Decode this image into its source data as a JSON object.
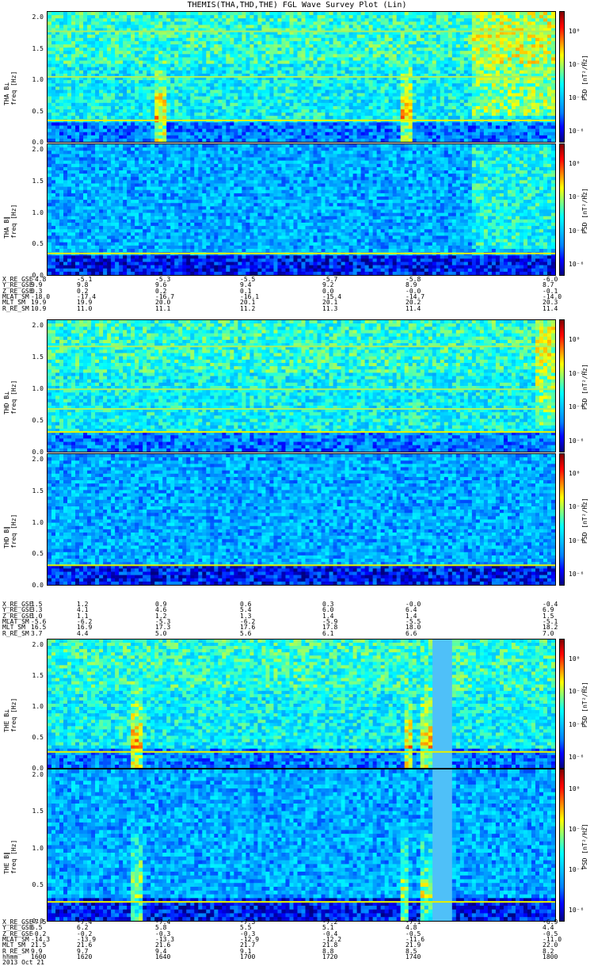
{
  "title": "THEMIS(THA,THD,THE) FGL Wave Survey Plot (Lin)",
  "colors": {
    "background": "#ffffff",
    "ink": "#000000",
    "colormap": [
      "#000080",
      "#0000ff",
      "#0080ff",
      "#00c0ff",
      "#00ffff",
      "#80ff80",
      "#ffff00",
      "#ff8000",
      "#ff0000",
      "#800000"
    ]
  },
  "freq_axis": {
    "ticks": [
      "0.0",
      "0.5",
      "1.0",
      "1.5",
      "2.0"
    ],
    "label": "freq [Hz]"
  },
  "colorbar": {
    "label": "PSD [nT²/Hz]",
    "ticks": [
      "10⁰",
      "10⁻²",
      "10⁻⁴",
      "10⁻⁶"
    ]
  },
  "panels": [
    {
      "id": "tha_bl",
      "name": "THA B⊥",
      "ylabel_prefix": "THA B⊥"
    },
    {
      "id": "tha_bpar",
      "name": "THA B∥",
      "ylabel_prefix": "THA B∥"
    },
    {
      "id": "thd_bl",
      "name": "THD B⊥",
      "ylabel_prefix": "THD B⊥"
    },
    {
      "id": "thd_bpar",
      "name": "THD B∥",
      "ylabel_prefix": "THD B∥"
    },
    {
      "id": "the_bl",
      "name": "THE B⊥",
      "ylabel_prefix": "THE B⊥"
    },
    {
      "id": "the_bpar",
      "name": "THE B∥",
      "ylabel_prefix": "THE B∥"
    }
  ],
  "ephemeris": [
    {
      "rows": [
        {
          "name": "X_RE_GSE",
          "values": [
            "-4.8",
            "-5.1",
            "-5.3",
            "-5.5",
            "-5.7",
            "-5.8",
            "-6.0"
          ]
        },
        {
          "name": "Y_RE_GSE",
          "values": [
            "9.9",
            "9.8",
            "9.6",
            "9.4",
            "9.2",
            "8.9",
            "8.7"
          ]
        },
        {
          "name": "Z_RE_GSE",
          "values": [
            "0.3",
            "0.2",
            "0.2",
            "0.1",
            "0.0",
            "-0.0",
            "-0.1"
          ]
        },
        {
          "name": "MLAT_SM",
          "values": [
            "-18.0",
            "-17.4",
            "-16.7",
            "-16.1",
            "-15.4",
            "-14.7",
            "-14.0"
          ]
        },
        {
          "name": "MLT_SM",
          "values": [
            "19.9",
            "19.9",
            "20.0",
            "20.1",
            "20.1",
            "20.2",
            "20.3"
          ]
        },
        {
          "name": "R_RE_SM",
          "values": [
            "10.9",
            "11.0",
            "11.1",
            "11.2",
            "11.3",
            "11.4",
            "11.4"
          ]
        }
      ]
    },
    {
      "rows": [
        {
          "name": "X_RE_GSE",
          "values": [
            "1.5",
            "1.2",
            "0.9",
            "0.6",
            "0.3",
            "-0.0",
            "-0.4"
          ]
        },
        {
          "name": "Y_RE_GSE",
          "values": [
            "3.3",
            "4.1",
            "4.6",
            "5.4",
            "6.0",
            "6.4",
            "6.9"
          ]
        },
        {
          "name": "Z_RE_GSE",
          "values": [
            "1.0",
            "1.1",
            "1.2",
            "1.3",
            "1.4",
            "1.4",
            "1.5"
          ]
        },
        {
          "name": "MLAT_SM",
          "values": [
            "-5.6",
            "-6.2",
            "-5.3",
            "-6.2",
            "-5.9",
            "-5.5",
            "-5.1"
          ]
        },
        {
          "name": "MLT_SM",
          "values": [
            "16.5",
            "16.9",
            "17.3",
            "17.6",
            "17.8",
            "18.0",
            "18.2"
          ]
        },
        {
          "name": "R_RE_SM",
          "values": [
            "3.7",
            "4.4",
            "5.0",
            "5.6",
            "6.1",
            "6.6",
            "7.0"
          ]
        }
      ]
    },
    {
      "rows": [
        {
          "name": "X_RE_GSE",
          "values": [
            "-7.5",
            "-7.4",
            "-7.4",
            "-7.3",
            "-7.2",
            "-7.1",
            "-6.9"
          ]
        },
        {
          "name": "Y_RE_GSE",
          "values": [
            "6.5",
            "6.2",
            "5.8",
            "5.5",
            "5.1",
            "4.8",
            "4.4"
          ]
        },
        {
          "name": "Z_RE_GSE",
          "values": [
            "-0.2",
            "-0.2",
            "-0.3",
            "-0.3",
            "-0.4",
            "-0.5",
            "-0.5"
          ]
        },
        {
          "name": "MLAT_SM",
          "values": [
            "-14.3",
            "-13.9",
            "-13.3",
            "-12.9",
            "-12.2",
            "-11.6",
            "-11.0"
          ]
        },
        {
          "name": "MLT_SM",
          "values": [
            "21.5",
            "21.6",
            "21.6",
            "21.7",
            "21.8",
            "21.9",
            "22.0"
          ]
        },
        {
          "name": "R_RE_SM",
          "values": [
            "9.9",
            "9.7",
            "9.4",
            "9.1",
            "8.8",
            "8.5",
            "8.2"
          ]
        },
        {
          "name": "hhmm",
          "values": [
            "1600",
            "1620",
            "1640",
            "1700",
            "1720",
            "1740",
            "1800"
          ]
        }
      ]
    }
  ],
  "date_label": "2013 Oct 21",
  "chart_data": [
    {
      "type": "heatmap",
      "title": "THEMIS(THA,THD,THE) FGL Wave Survey Plot (Lin)",
      "xlabel": "hhmm",
      "x_ticks": [
        "1600",
        "1620",
        "1640",
        "1700",
        "1720",
        "1740",
        "1800"
      ],
      "ylabel": "THA B⊥ freq [Hz]",
      "ylim": [
        0,
        2.0
      ],
      "series": [
        {
          "name": "THA B⊥"
        }
      ],
      "features": {
        "lines_hz": [
          0.33,
          1.0,
          1.7
        ],
        "bursts_min": [
          26.0,
          84.5
        ],
        "high_band_after_min": 100
      }
    },
    {
      "type": "heatmap",
      "ylabel": "THA B∥ freq [Hz]",
      "ylim": [
        0,
        2.0
      ],
      "series": [
        {
          "name": "THA B∥"
        }
      ],
      "features": {
        "lines_hz": [
          0.33
        ],
        "bursts_min": [],
        "high_band_after_min": 100
      }
    },
    {
      "type": "heatmap",
      "ylabel": "THD B⊥ freq [Hz]",
      "ylim": [
        0,
        2.0
      ],
      "series": [
        {
          "name": "THD B⊥"
        }
      ],
      "features": {
        "lines_hz": [
          0.3,
          0.65,
          0.95,
          1.6
        ],
        "bursts_min": [],
        "high_band_after_min": 115
      }
    },
    {
      "type": "heatmap",
      "ylabel": "THD B∥ freq [Hz]",
      "ylim": [
        0,
        2.0
      ],
      "series": [
        {
          "name": "THD B∥"
        }
      ],
      "features": {
        "lines_hz": [
          0.3
        ],
        "bursts_min": [],
        "high_band_after_min": 200
      }
    },
    {
      "type": "heatmap",
      "ylabel": "THE B⊥ freq [Hz]",
      "ylim": [
        0,
        2.0
      ],
      "series": [
        {
          "name": "THE B⊥"
        }
      ],
      "features": {
        "lines_hz": [
          0.25
        ],
        "bursts_min": [
          20.5,
          85.0,
          89.0
        ],
        "data_gap_min": [
          90.5,
          95.0
        ]
      }
    },
    {
      "type": "heatmap",
      "ylabel": "THE B∥ freq [Hz]",
      "ylim": [
        0,
        2.0
      ],
      "series": [
        {
          "name": "THE B∥"
        }
      ],
      "features": {
        "lines_hz": [
          0.25
        ],
        "bursts_min": [
          20.5,
          84.0,
          89.0
        ],
        "data_gap_min": [
          90.5,
          95.0
        ]
      }
    }
  ]
}
